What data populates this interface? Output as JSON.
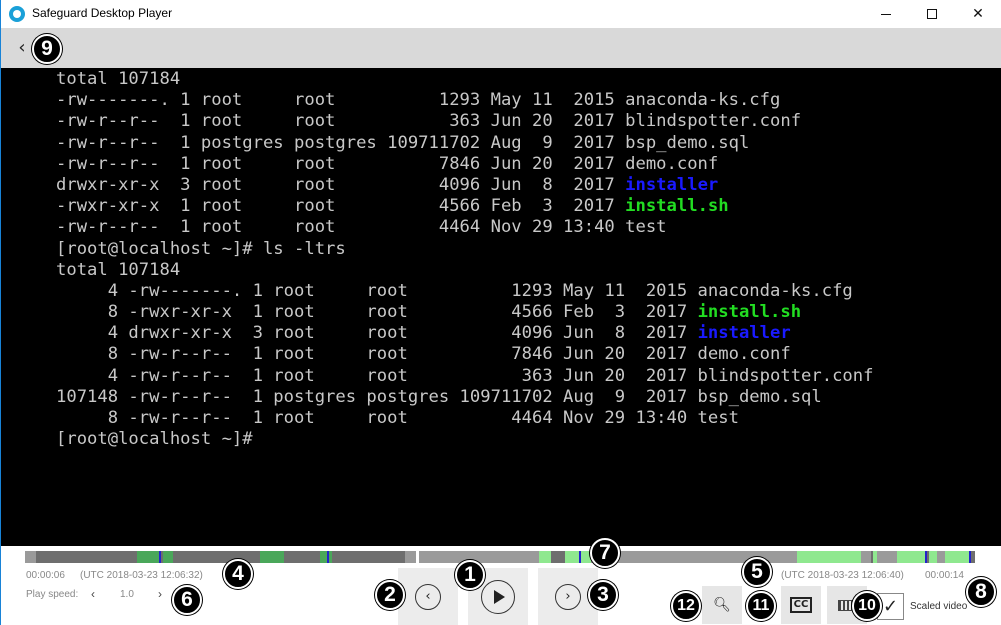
{
  "window": {
    "title": "Safeguard Desktop Player",
    "controls": {
      "minimize": "",
      "maximize": "",
      "close": "✕"
    }
  },
  "nav": {
    "back_label": "‹"
  },
  "terminal": {
    "lines": [
      {
        "text": "total 107184"
      },
      {
        "text": "-rw-------. 1 root     root          1293 May 11  2015 anaconda-ks.cfg"
      },
      {
        "text": "-rw-r--r--  1 root     root           363 Jun 20  2017 blindspotter.conf"
      },
      {
        "text": "-rw-r--r--  1 postgres postgres 109711702 Aug  9  2017 bsp_demo.sql"
      },
      {
        "text": "-rw-r--r--  1 root     root          7846 Jun 20  2017 demo.conf"
      },
      {
        "text": "drwxr-xr-x  3 root     root          4096 Jun  8  2017 ",
        "highlight": "installer",
        "color": "blue"
      },
      {
        "text": "-rwxr-xr-x  1 root     root          4566 Feb  3  2017 ",
        "highlight": "install.sh",
        "color": "green"
      },
      {
        "text": "-rw-r--r--  1 root     root          4464 Nov 29 13:40 test"
      },
      {
        "text": "[root@localhost ~]# ls -ltrs"
      },
      {
        "text": "total 107184"
      },
      {
        "text": "     4 -rw-------. 1 root     root          1293 May 11  2015 anaconda-ks.cfg"
      },
      {
        "text": "     8 -rwxr-xr-x  1 root     root          4566 Feb  3  2017 ",
        "highlight": "install.sh",
        "color": "green"
      },
      {
        "text": "     4 drwxr-xr-x  3 root     root          4096 Jun  8  2017 ",
        "highlight": "installer",
        "color": "blue"
      },
      {
        "text": "     8 -rw-r--r--  1 root     root          7846 Jun 20  2017 demo.conf"
      },
      {
        "text": "     4 -rw-r--r--  1 root     root           363 Jun 20  2017 blindspotter.conf"
      },
      {
        "text": "107148 -rw-r--r--  1 postgres postgres 109711702 Aug  9  2017 bsp_demo.sql"
      },
      {
        "text": "     8 -rw-r--r--  1 root     root          4464 Nov 29 13:40 test"
      },
      {
        "text": "[root@localhost ~]#"
      }
    ]
  },
  "player": {
    "time_elapsed": "00:00:06",
    "utc_current": "(UTC 2018-03-23 12:06:32)",
    "utc_end": "(UTC 2018-03-23 12:06:40)",
    "time_total": "00:00:14",
    "speed_label": "Play speed:",
    "speed_value": "1.0",
    "speed_dec": "‹",
    "speed_inc": "›",
    "prev_icon": "chevron-left-icon",
    "play_icon": "play-icon",
    "next_icon": "chevron-right-icon",
    "cc_label": "CC",
    "scaled_video_label": "Scaled video",
    "scaled_video_checked": "✓",
    "position_fraction": 0.41
  },
  "colors": {
    "activity_dark": "#4aa75a",
    "activity_light": "#8fe88f",
    "timeline_base": "#6e6e6e",
    "marker_blue": "#2222cc",
    "dir_blue": "#1a1aff",
    "exec_green": "#22dd22"
  },
  "callouts": [
    "1",
    "2",
    "3",
    "4",
    "5",
    "6",
    "7",
    "8",
    "9",
    "10",
    "11",
    "12"
  ]
}
